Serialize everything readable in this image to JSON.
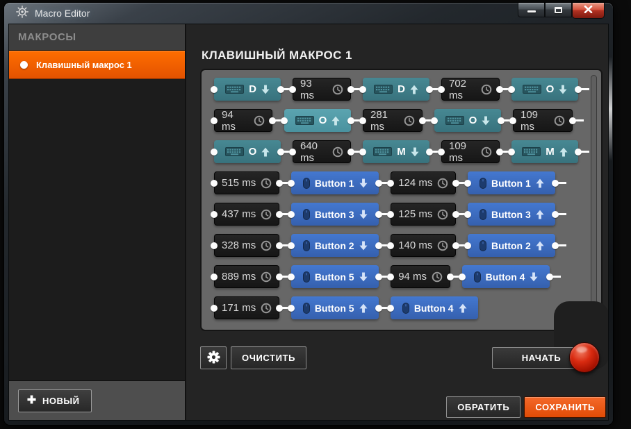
{
  "window": {
    "title": "Macro Editor",
    "logo_icon": "steelseries-logo",
    "controls": [
      {
        "name": "minimize",
        "icon": "minimize-icon"
      },
      {
        "name": "maximize",
        "icon": "maximize-icon"
      },
      {
        "name": "close",
        "icon": "close-icon"
      }
    ]
  },
  "sidebar": {
    "header": "МАКРОСЫ",
    "items": [
      {
        "label": "Клавишный макрос 1",
        "selected": true,
        "bullet_icon": "selected-dot"
      }
    ],
    "new_button": {
      "label": "НОВЫЙ",
      "icon": "plus-icon"
    }
  },
  "main": {
    "title": "КЛАВИШНЫЙ МАКРОС 1",
    "toolbar": {
      "settings_icon": "gear-icon",
      "clear_label": "ОЧИСТИТЬ",
      "start_label": "НАЧАТЬ",
      "record_icon": "record-button"
    },
    "actions": {
      "revert_label": "ОБРАТИТЬ",
      "save_label": "СОХРАНИТЬ"
    }
  },
  "macro_steps": [
    [
      {
        "type": "key",
        "key": "D",
        "direction": "down"
      },
      {
        "type": "delay",
        "value": "93 ms"
      },
      {
        "type": "key",
        "key": "D",
        "direction": "up"
      },
      {
        "type": "delay",
        "value": "702 ms"
      },
      {
        "type": "key",
        "key": "O",
        "direction": "down"
      }
    ],
    [
      {
        "type": "delay",
        "value": "94 ms"
      },
      {
        "type": "key",
        "key": "O",
        "direction": "up",
        "highlighted": true
      },
      {
        "type": "delay",
        "value": "281 ms"
      },
      {
        "type": "key",
        "key": "O",
        "direction": "down"
      },
      {
        "type": "delay",
        "value": "109 ms"
      }
    ],
    [
      {
        "type": "key",
        "key": "O",
        "direction": "up"
      },
      {
        "type": "delay",
        "value": "640 ms"
      },
      {
        "type": "key",
        "key": "M",
        "direction": "down"
      },
      {
        "type": "delay",
        "value": "109 ms"
      },
      {
        "type": "key",
        "key": "M",
        "direction": "up"
      }
    ],
    [
      {
        "type": "delay",
        "value": "515 ms"
      },
      {
        "type": "mouse",
        "key": "Button 1",
        "direction": "down"
      },
      {
        "type": "delay",
        "value": "124 ms"
      },
      {
        "type": "mouse",
        "key": "Button 1",
        "direction": "up"
      }
    ],
    [
      {
        "type": "delay",
        "value": "437 ms"
      },
      {
        "type": "mouse",
        "key": "Button 3",
        "direction": "down"
      },
      {
        "type": "delay",
        "value": "125 ms"
      },
      {
        "type": "mouse",
        "key": "Button 3",
        "direction": "up"
      }
    ],
    [
      {
        "type": "delay",
        "value": "328 ms"
      },
      {
        "type": "mouse",
        "key": "Button 2",
        "direction": "down"
      },
      {
        "type": "delay",
        "value": "140 ms"
      },
      {
        "type": "mouse",
        "key": "Button 2",
        "direction": "up"
      }
    ],
    [
      {
        "type": "delay",
        "value": "889 ms"
      },
      {
        "type": "mouse",
        "key": "Button 5",
        "direction": "down"
      },
      {
        "type": "delay",
        "value": "94 ms"
      },
      {
        "type": "mouse",
        "key": "Button 4",
        "direction": "down"
      }
    ],
    [
      {
        "type": "delay",
        "value": "171 ms"
      },
      {
        "type": "mouse",
        "key": "Button 5",
        "direction": "up"
      },
      {
        "type": "mouse",
        "key": "Button 4",
        "direction": "up"
      }
    ]
  ],
  "colors": {
    "accent_orange": "#f06000",
    "save_orange": "#e8531a",
    "key_block_teal": "#3f7e89",
    "key_block_highlight": "#54a0ad",
    "mouse_block_blue": "#3c6cc1",
    "delay_block_dark": "#1d1d1d",
    "record_red": "#c51400",
    "panel_gray": "#676767"
  }
}
